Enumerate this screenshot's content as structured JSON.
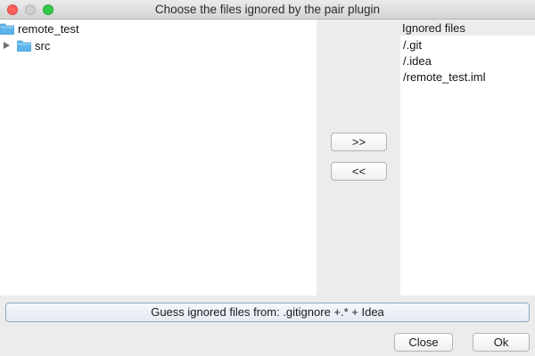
{
  "window": {
    "title": "Choose the files ignored by the pair plugin"
  },
  "tree": {
    "root": {
      "label": "remote_test",
      "icon": "folder-icon"
    },
    "children": [
      {
        "label": "src",
        "icon": "folder-icon",
        "expanded": false
      }
    ]
  },
  "transfer": {
    "add_label": ">>",
    "remove_label": "<<"
  },
  "ignored": {
    "header": "Ignored files",
    "items": [
      "/.git",
      "/.idea",
      "/remote_test.iml"
    ]
  },
  "guess_button_label": "Guess ignored files from:  .gitignore +.* + Idea",
  "footer": {
    "close_label": "Close",
    "ok_label": "Ok"
  },
  "colors": {
    "folder": "#5db4ea",
    "close_dot": "#fc605b",
    "max_dot": "#34c84a"
  }
}
